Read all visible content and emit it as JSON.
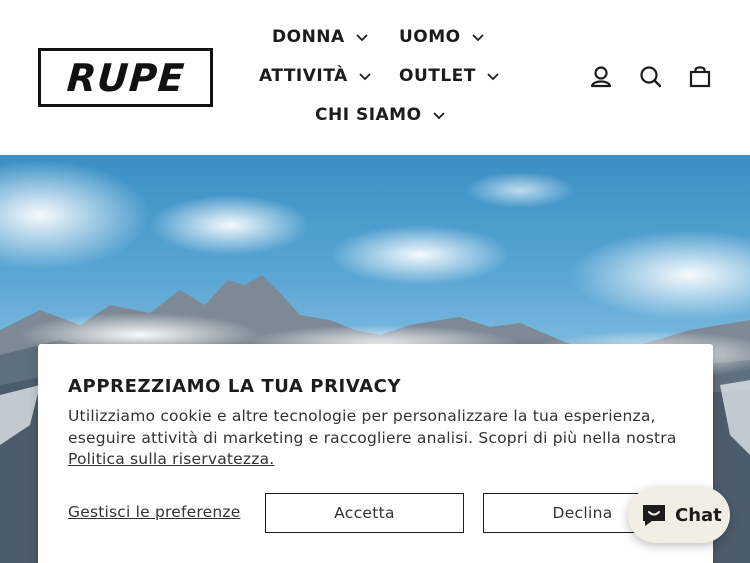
{
  "brand": {
    "logo_text": "RUPE"
  },
  "nav": {
    "donna": "DONNA",
    "uomo": "UOMO",
    "attivita": "ATTIVITÀ",
    "outlet": "OUTLET",
    "chi_siamo": "CHI SIAMO"
  },
  "header_icons": [
    "account-icon",
    "search-icon",
    "cart-icon"
  ],
  "cookie": {
    "title": "APPREZZIAMO LA TUA PRIVACY",
    "text": "Utilizziamo cookie e altre tecnologie per personalizzare la tua esperienza, eseguire attività di marketing e raccogliere analisi. Scopri di più nella nostra ",
    "policy_link": "Politica sulla riservatezza.",
    "manage_label": "Gestisci le preferenze",
    "accept_label": "Accetta",
    "decline_label": "Declina"
  },
  "chat": {
    "label": "Chat"
  },
  "colors": {
    "text": "#1c1c1c",
    "chat_bg": "#f1efe5",
    "sky": "#5aa6d4"
  }
}
